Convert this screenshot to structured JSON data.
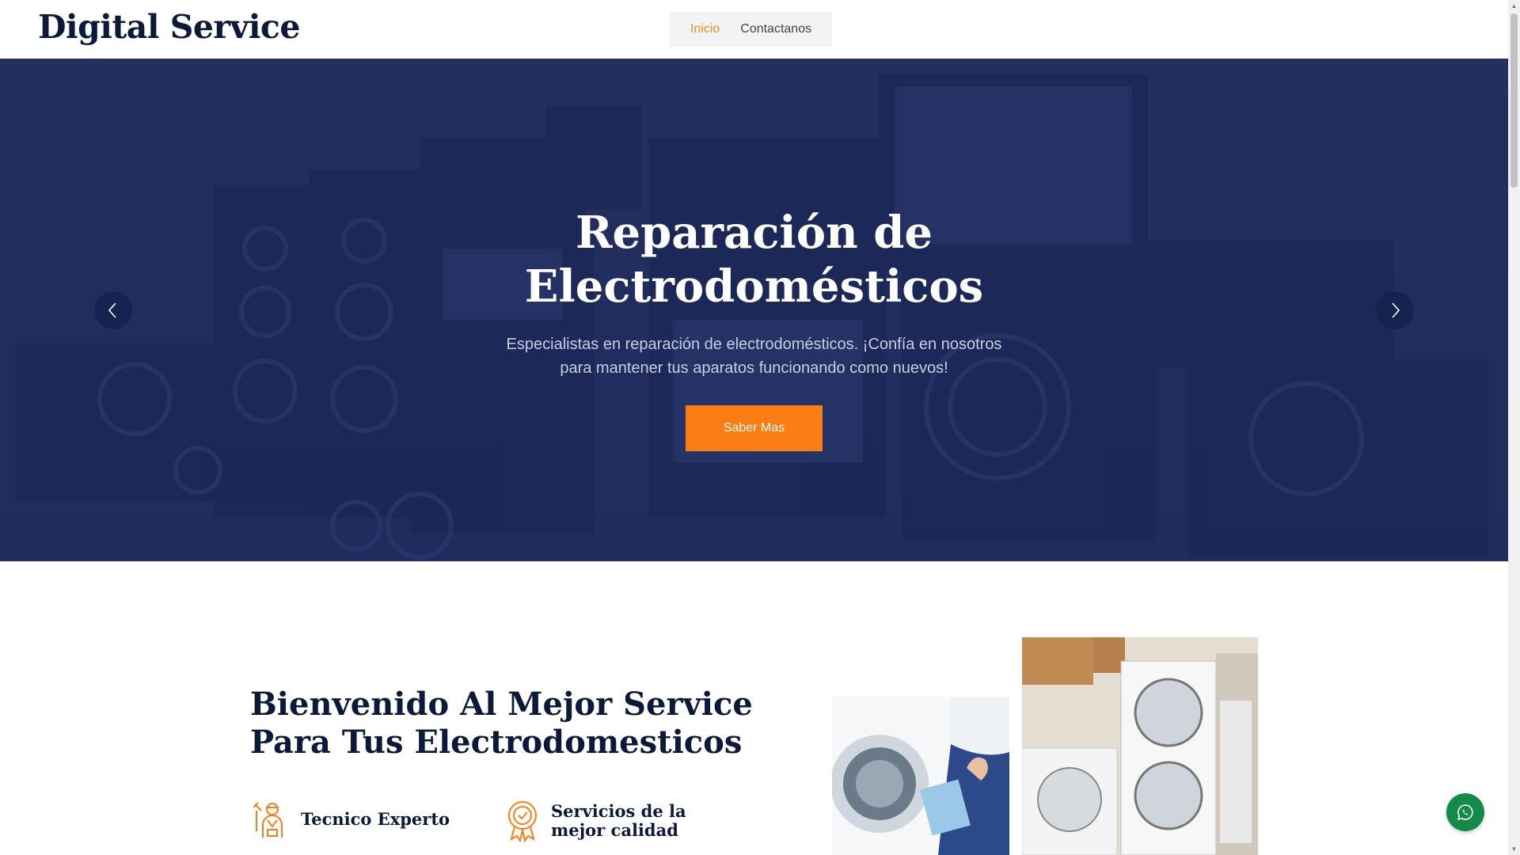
{
  "header": {
    "brand": "Digital Service",
    "nav": [
      {
        "label": "Inicio",
        "active": true
      },
      {
        "label": "Contactanos",
        "active": false
      }
    ]
  },
  "hero": {
    "title": "Reparación de Electrodomésticos",
    "subtitle": "Especialistas en reparación de electrodomésticos. ¡Confía en nosotros para mantener tus aparatos funcionando como nuevos!",
    "button_label": "Saber Mas",
    "prev_icon": "chevron-left-icon",
    "next_icon": "chevron-right-icon"
  },
  "welcome": {
    "title": "Bienvenido Al Mejor Service Para Tus Electrodomesticos",
    "features": [
      {
        "label": "Tecnico Experto",
        "icon": "technician-icon"
      },
      {
        "label": "Servicios de la mejor calidad",
        "icon": "award-icon"
      }
    ]
  },
  "floating": {
    "icon": "whatsapp-icon"
  },
  "colors": {
    "accent": "#fb7e14",
    "navy": "#0b1a3a",
    "hero_overlay": "#1a265a",
    "whatsapp": "#138a47"
  }
}
